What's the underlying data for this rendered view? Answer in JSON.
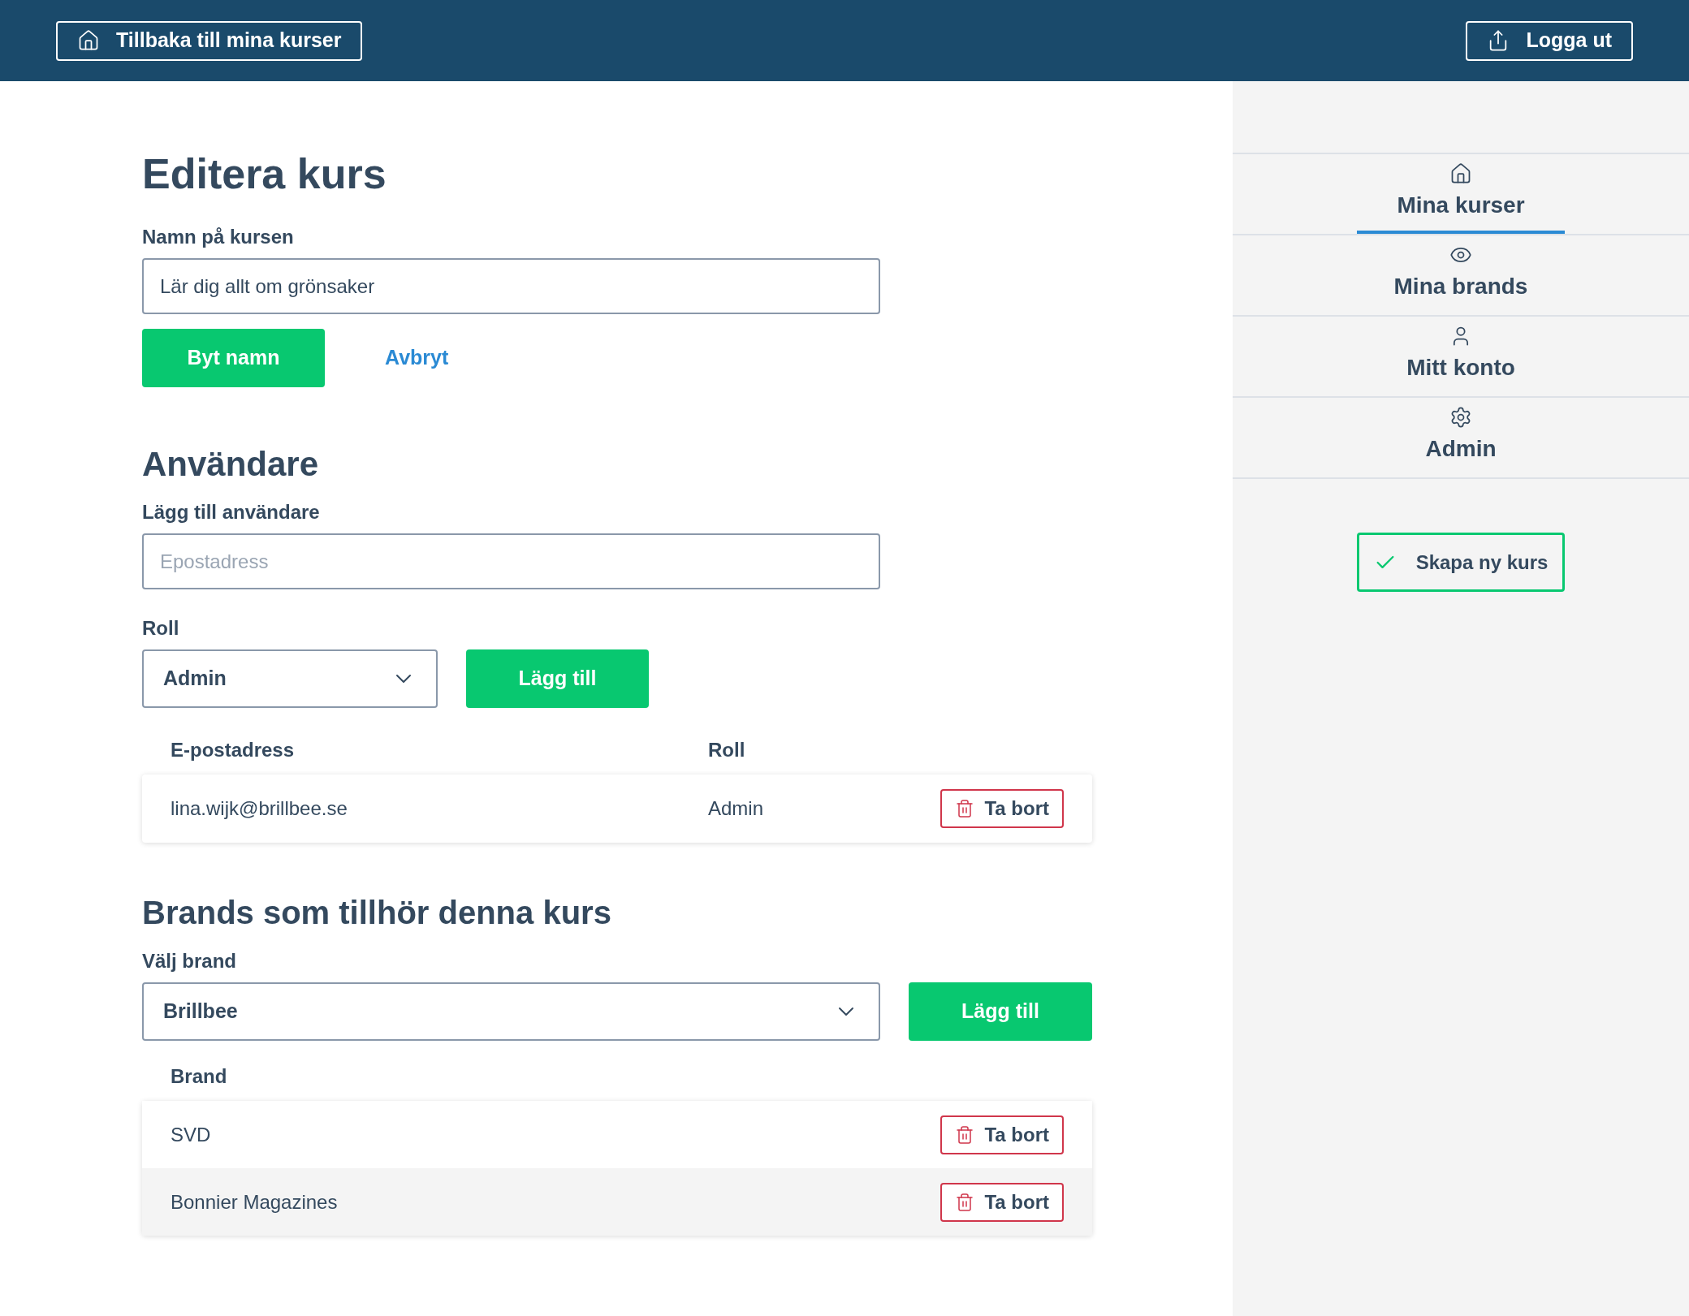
{
  "header": {
    "back_button": "Tillbaka till mina kurser",
    "logout_button": "Logga ut"
  },
  "page_title": "Editera kurs",
  "course_name": {
    "label": "Namn på kursen",
    "value": "Lär dig allt om grönsaker",
    "rename_button": "Byt namn",
    "cancel_link": "Avbryt"
  },
  "users": {
    "heading": "Användare",
    "add_label": "Lägg till användare",
    "email_placeholder": "Epostadress",
    "role_label": "Roll",
    "role_value": "Admin",
    "add_button": "Lägg till",
    "columns": [
      "E-postadress",
      "Roll"
    ],
    "rows": [
      {
        "email": "lina.wijk@brillbee.se",
        "role": "Admin",
        "remove_button": "Ta bort"
      }
    ]
  },
  "brands": {
    "heading": "Brands som tillhör denna kurs",
    "select_label": "Välj brand",
    "select_value": "Brillbee",
    "add_button": "Lägg till",
    "columns": [
      "Brand"
    ],
    "rows": [
      {
        "name": "SVD",
        "remove_button": "Ta bort"
      },
      {
        "name": "Bonnier Magazines",
        "remove_button": "Ta bort"
      }
    ]
  },
  "sidebar": {
    "items": [
      {
        "label": "Mina kurser",
        "selected": true
      },
      {
        "label": "Mina brands",
        "selected": false
      },
      {
        "label": "Mitt konto",
        "selected": false
      },
      {
        "label": "Admin",
        "selected": false
      }
    ],
    "create_button": "Skapa ny kurs"
  }
}
